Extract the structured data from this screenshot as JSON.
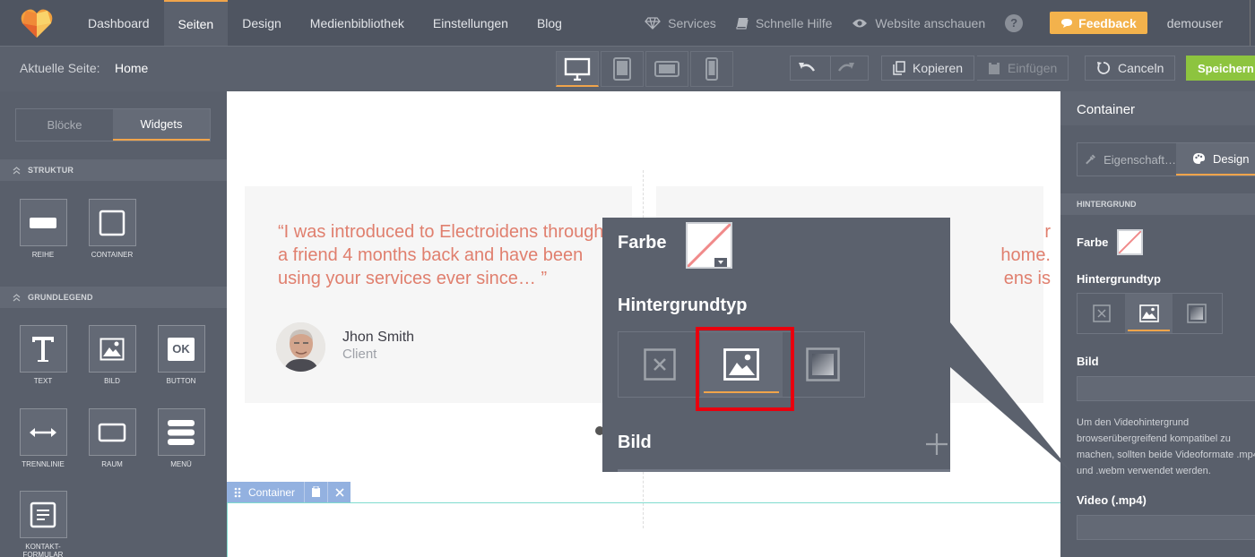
{
  "topbar": {
    "nav": [
      {
        "label": "Dashboard",
        "active": false
      },
      {
        "label": "Seiten",
        "active": true
      },
      {
        "label": "Design",
        "active": false
      },
      {
        "label": "Medienbibliothek",
        "active": false
      },
      {
        "label": "Einstellungen",
        "active": false
      },
      {
        "label": "Blog",
        "active": false
      }
    ],
    "services": "Services",
    "quick_help": "Schnelle Hilfe",
    "view_site": "Website anschauen",
    "help": "?",
    "feedback": "Feedback",
    "user": "demouser"
  },
  "secondbar": {
    "current_label": "Aktuelle Seite:",
    "current_page": "Home",
    "devices": [
      "desktop",
      "tablet",
      "tablet-landscape",
      "phone"
    ],
    "active_device": "desktop",
    "copy": "Kopieren",
    "paste": "Einfügen",
    "cancel": "Canceln",
    "save": "Speichern"
  },
  "leftpanel": {
    "tabs": [
      {
        "label": "Blöcke",
        "active": false
      },
      {
        "label": "Widgets",
        "active": true
      }
    ],
    "sections": [
      {
        "title": "STRUKTUR",
        "widgets": [
          {
            "label": "REIHE",
            "icon": "row-icon"
          },
          {
            "label": "CONTAINER",
            "icon": "container-icon"
          }
        ]
      },
      {
        "title": "GRUNDLEGEND",
        "widgets": [
          {
            "label": "TEXT",
            "icon": "text-icon"
          },
          {
            "label": "BILD",
            "icon": "image-icon"
          },
          {
            "label": "BUTTON",
            "icon": "button-icon",
            "badge": "OK"
          },
          {
            "label": "TRENNLINIE",
            "icon": "divider-icon"
          },
          {
            "label": "RAUM",
            "icon": "space-icon"
          },
          {
            "label": "MENÜ",
            "icon": "menu-icon"
          },
          {
            "label": "KONTAKT-FORMULAR",
            "icon": "contact-form-icon"
          }
        ]
      }
    ]
  },
  "canvas": {
    "quote": "“I was introduced to Electroidens through a friend 4 months back and have been using your services ever since… ”",
    "author": "Jhon Smith",
    "role": "Client",
    "quote2_lines": [
      "r",
      "home.",
      "ens is"
    ],
    "container_tag": "Container"
  },
  "zoom": {
    "farbe": "Farbe",
    "hintergrundtyp": "Hintergrundtyp",
    "bild": "Bild",
    "options": [
      "none",
      "image",
      "gradient"
    ],
    "active": "image"
  },
  "rightpanel": {
    "title": "Container",
    "tabs": [
      {
        "label": "Eigenschaft…",
        "active": false
      },
      {
        "label": "Design",
        "active": true
      }
    ],
    "section": "HINTERGRUND",
    "farbe": "Farbe",
    "hintergrundtyp": "Hintergrundtyp",
    "bild": "Bild",
    "hint": "Um den Videohintergrund browserübergreifend kompatibel zu machen, sollten beide Videoformate .mp4 und .webm verwendet werden.",
    "video": "Video (.mp4)"
  },
  "colors": {
    "topbar": "#4f5561",
    "panel": "#595f6b",
    "accent": "#f0a44b",
    "save": "#8dc43f",
    "feedback": "#f3b24c",
    "quote": "#e07f6e",
    "highlight": "#e8000e"
  }
}
